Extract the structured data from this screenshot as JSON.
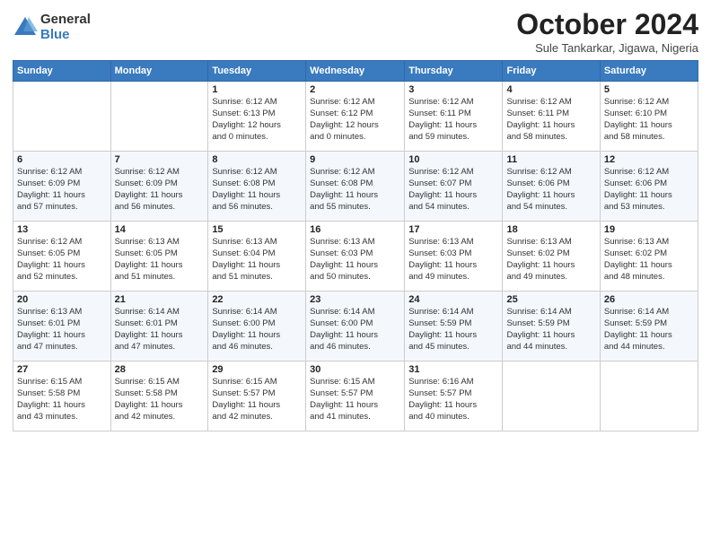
{
  "header": {
    "logo_general": "General",
    "logo_blue": "Blue",
    "title": "October 2024",
    "subtitle": "Sule Tankarkar, Jigawa, Nigeria"
  },
  "calendar": {
    "days_of_week": [
      "Sunday",
      "Monday",
      "Tuesday",
      "Wednesday",
      "Thursday",
      "Friday",
      "Saturday"
    ],
    "weeks": [
      [
        {
          "day": "",
          "info": ""
        },
        {
          "day": "",
          "info": ""
        },
        {
          "day": "1",
          "info": "Sunrise: 6:12 AM\nSunset: 6:13 PM\nDaylight: 12 hours\nand 0 minutes."
        },
        {
          "day": "2",
          "info": "Sunrise: 6:12 AM\nSunset: 6:12 PM\nDaylight: 12 hours\nand 0 minutes."
        },
        {
          "day": "3",
          "info": "Sunrise: 6:12 AM\nSunset: 6:11 PM\nDaylight: 11 hours\nand 59 minutes."
        },
        {
          "day": "4",
          "info": "Sunrise: 6:12 AM\nSunset: 6:11 PM\nDaylight: 11 hours\nand 58 minutes."
        },
        {
          "day": "5",
          "info": "Sunrise: 6:12 AM\nSunset: 6:10 PM\nDaylight: 11 hours\nand 58 minutes."
        }
      ],
      [
        {
          "day": "6",
          "info": "Sunrise: 6:12 AM\nSunset: 6:09 PM\nDaylight: 11 hours\nand 57 minutes."
        },
        {
          "day": "7",
          "info": "Sunrise: 6:12 AM\nSunset: 6:09 PM\nDaylight: 11 hours\nand 56 minutes."
        },
        {
          "day": "8",
          "info": "Sunrise: 6:12 AM\nSunset: 6:08 PM\nDaylight: 11 hours\nand 56 minutes."
        },
        {
          "day": "9",
          "info": "Sunrise: 6:12 AM\nSunset: 6:08 PM\nDaylight: 11 hours\nand 55 minutes."
        },
        {
          "day": "10",
          "info": "Sunrise: 6:12 AM\nSunset: 6:07 PM\nDaylight: 11 hours\nand 54 minutes."
        },
        {
          "day": "11",
          "info": "Sunrise: 6:12 AM\nSunset: 6:06 PM\nDaylight: 11 hours\nand 54 minutes."
        },
        {
          "day": "12",
          "info": "Sunrise: 6:12 AM\nSunset: 6:06 PM\nDaylight: 11 hours\nand 53 minutes."
        }
      ],
      [
        {
          "day": "13",
          "info": "Sunrise: 6:12 AM\nSunset: 6:05 PM\nDaylight: 11 hours\nand 52 minutes."
        },
        {
          "day": "14",
          "info": "Sunrise: 6:13 AM\nSunset: 6:05 PM\nDaylight: 11 hours\nand 51 minutes."
        },
        {
          "day": "15",
          "info": "Sunrise: 6:13 AM\nSunset: 6:04 PM\nDaylight: 11 hours\nand 51 minutes."
        },
        {
          "day": "16",
          "info": "Sunrise: 6:13 AM\nSunset: 6:03 PM\nDaylight: 11 hours\nand 50 minutes."
        },
        {
          "day": "17",
          "info": "Sunrise: 6:13 AM\nSunset: 6:03 PM\nDaylight: 11 hours\nand 49 minutes."
        },
        {
          "day": "18",
          "info": "Sunrise: 6:13 AM\nSunset: 6:02 PM\nDaylight: 11 hours\nand 49 minutes."
        },
        {
          "day": "19",
          "info": "Sunrise: 6:13 AM\nSunset: 6:02 PM\nDaylight: 11 hours\nand 48 minutes."
        }
      ],
      [
        {
          "day": "20",
          "info": "Sunrise: 6:13 AM\nSunset: 6:01 PM\nDaylight: 11 hours\nand 47 minutes."
        },
        {
          "day": "21",
          "info": "Sunrise: 6:14 AM\nSunset: 6:01 PM\nDaylight: 11 hours\nand 47 minutes."
        },
        {
          "day": "22",
          "info": "Sunrise: 6:14 AM\nSunset: 6:00 PM\nDaylight: 11 hours\nand 46 minutes."
        },
        {
          "day": "23",
          "info": "Sunrise: 6:14 AM\nSunset: 6:00 PM\nDaylight: 11 hours\nand 46 minutes."
        },
        {
          "day": "24",
          "info": "Sunrise: 6:14 AM\nSunset: 5:59 PM\nDaylight: 11 hours\nand 45 minutes."
        },
        {
          "day": "25",
          "info": "Sunrise: 6:14 AM\nSunset: 5:59 PM\nDaylight: 11 hours\nand 44 minutes."
        },
        {
          "day": "26",
          "info": "Sunrise: 6:14 AM\nSunset: 5:59 PM\nDaylight: 11 hours\nand 44 minutes."
        }
      ],
      [
        {
          "day": "27",
          "info": "Sunrise: 6:15 AM\nSunset: 5:58 PM\nDaylight: 11 hours\nand 43 minutes."
        },
        {
          "day": "28",
          "info": "Sunrise: 6:15 AM\nSunset: 5:58 PM\nDaylight: 11 hours\nand 42 minutes."
        },
        {
          "day": "29",
          "info": "Sunrise: 6:15 AM\nSunset: 5:57 PM\nDaylight: 11 hours\nand 42 minutes."
        },
        {
          "day": "30",
          "info": "Sunrise: 6:15 AM\nSunset: 5:57 PM\nDaylight: 11 hours\nand 41 minutes."
        },
        {
          "day": "31",
          "info": "Sunrise: 6:16 AM\nSunset: 5:57 PM\nDaylight: 11 hours\nand 40 minutes."
        },
        {
          "day": "",
          "info": ""
        },
        {
          "day": "",
          "info": ""
        }
      ]
    ]
  }
}
